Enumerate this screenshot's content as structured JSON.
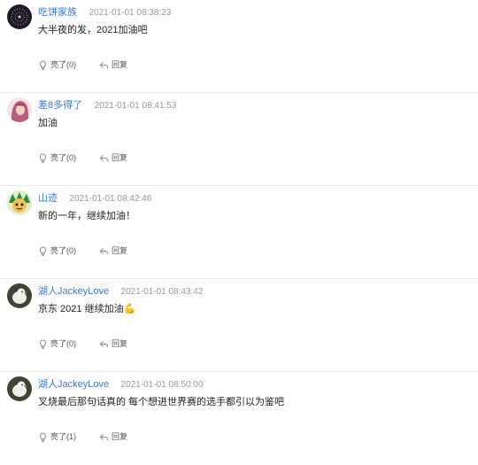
{
  "comments": [
    {
      "username": "吃饼家族",
      "time": "2021-01-01 08:38:23",
      "text": "大半夜的发，2021加油吧",
      "like_label": "亮了(0)",
      "reply_label": "回复",
      "avatar": "dark-firework-avatar"
    },
    {
      "username": "差8多得了",
      "time": "2021-01-01 08:41:53",
      "text": "加油",
      "like_label": "亮了(0)",
      "reply_label": "回复",
      "avatar": "pink-hair-avatar"
    },
    {
      "username": "山迹",
      "time": "2021-01-01 08:42:46",
      "text": "新的一年，继续加油！",
      "like_label": "亮了(0)",
      "reply_label": "回复",
      "avatar": "green-cartoon-avatar"
    },
    {
      "username": "湖人JackeyLove",
      "time": "2021-01-01 08:43:42",
      "text": "京东 2021 继续加油💪",
      "like_label": "亮了(0)",
      "reply_label": "回复",
      "avatar": "white-bird-avatar"
    },
    {
      "username": "湖人JackeyLove",
      "time": "2021-01-01 08:50:00",
      "text": "叉烧最后那句话真的 每个想进世界赛的选手都引以为鉴吧",
      "like_label": "亮了(1)",
      "reply_label": "回复",
      "avatar": "white-bird-avatar"
    }
  ],
  "colors": {
    "username": "#3a7bd5",
    "time": "#999999",
    "divider": "#ececec"
  },
  "icons": {
    "like": "lightbulb-icon",
    "reply": "reply-arrow-icon"
  }
}
